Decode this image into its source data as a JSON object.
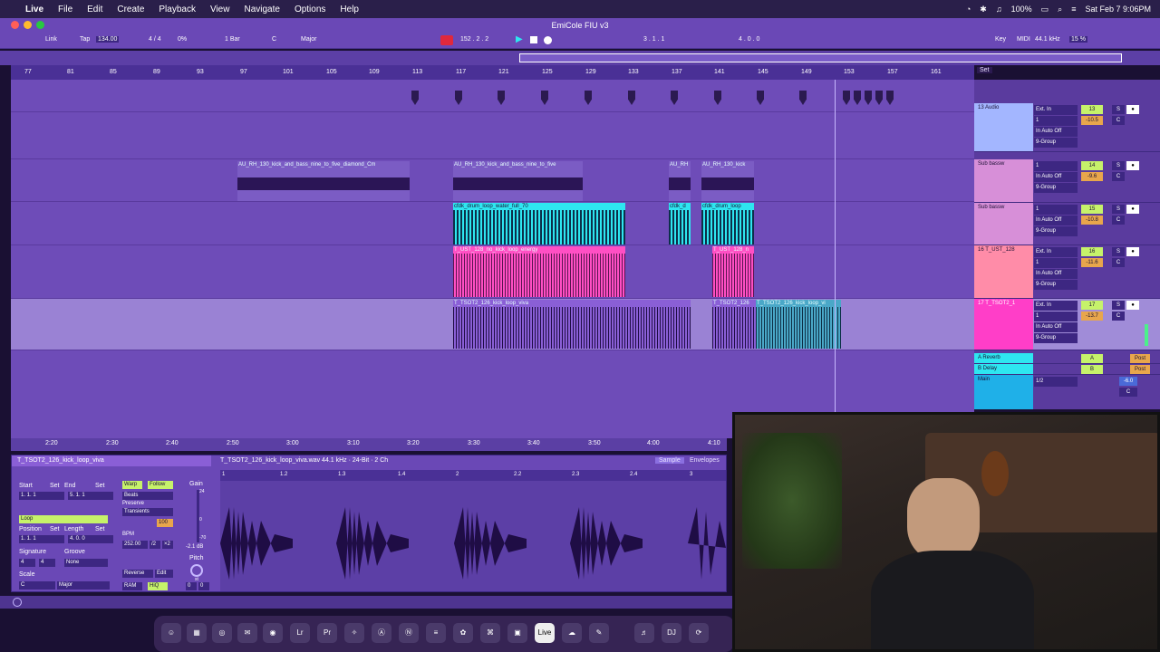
{
  "menubar": {
    "apple": "",
    "items": [
      "Live",
      "File",
      "Edit",
      "Create",
      "Playback",
      "View",
      "Navigate",
      "Options",
      "Help"
    ],
    "battery": "100%",
    "datetime": "Sat Feb 7  9:06PM"
  },
  "window": {
    "title": "EmiCole FIU v3"
  },
  "control": {
    "link": "Link",
    "tap": "Tap",
    "tempo": "134.00",
    "signature": "4 / 4",
    "percent": "0%",
    "quantize": "1 Bar",
    "key": "C",
    "scale": "Major",
    "position": "152 .  2 .  2",
    "loop_start": "3 .  1 .  1",
    "loop_length": "4 .  0 .  0",
    "key_btn": "Key",
    "midi_btn": "MIDI",
    "sample_rate": "44.1 kHz",
    "cpu": "15 %"
  },
  "ruler": {
    "bars": [
      "77",
      "81",
      "85",
      "89",
      "93",
      "97",
      "101",
      "105",
      "109",
      "113",
      "117",
      "121",
      "125",
      "129",
      "133",
      "137",
      "141",
      "145",
      "149",
      "153",
      "157",
      "161"
    ],
    "set": "Set"
  },
  "clips": [
    {
      "title": "AU_RH_130_kick_and_bass_nine_to_five_diamond_Cm",
      "color": "#7b5cc4"
    },
    {
      "title": "AU_RH_130_kick_and_bass_nine_to_five",
      "color": "#7b5cc4"
    },
    {
      "title": "AU_RH",
      "color": "#7b5cc4"
    },
    {
      "title": "AU_RH_130_kick",
      "color": "#7b5cc4"
    },
    {
      "title": "cfdk_drum_loop_water_full_70",
      "color": "#2ee6f0"
    },
    {
      "title": "cfdk_d",
      "color": "#2ee6f0"
    },
    {
      "title": "cfdk_drum_loop",
      "color": "#2ee6f0"
    },
    {
      "title": "T_UST_128_no_kick_loop_energy",
      "color": "#ff4fc4"
    },
    {
      "title": "T_UST_128_n",
      "color": "#ff4fc4"
    },
    {
      "title": "T_TSOT2_126_kick_loop_viva",
      "color": "#8a5fd6"
    },
    {
      "title": "T_TSOT2_126",
      "color": "#8a5fd6"
    },
    {
      "title": "T_TSOT2_126_kick_loop_vi",
      "color": "#4aa8c8"
    }
  ],
  "tracks": [
    {
      "name": "13 Audio",
      "input": "Ext. In",
      "ch": "1",
      "out": "9-Group",
      "num": "13",
      "vol": "-10.5",
      "pan": "C",
      "color": "#a3b6ff"
    },
    {
      "name": "Sub bassw",
      "input": "1",
      "ch": "",
      "out": "9-Group",
      "num": "14",
      "vol": "-9.6",
      "pan": "C",
      "color": "#d78fd8"
    },
    {
      "name": "Sub bassw",
      "input": "1",
      "ch": "",
      "out": "9-Group",
      "num": "15",
      "vol": "-10.8",
      "pan": "C",
      "color": "#d78fd8"
    },
    {
      "name": "16 T_UST_128",
      "input": "Ext. In",
      "ch": "1",
      "out": "9-Group",
      "num": "16",
      "vol": "-11.6",
      "pan": "C",
      "color": "#ff8ca8"
    },
    {
      "name": "17 T_TSOT2_1",
      "input": "Ext. In",
      "ch": "1",
      "out": "9-Group",
      "num": "17",
      "vol": "-13.7",
      "pan": "C",
      "color": "#ff3ec8"
    }
  ],
  "returns": [
    {
      "name": "A Reverb",
      "btn": "A",
      "post": "Post"
    },
    {
      "name": "B Delay",
      "btn": "B",
      "post": "Post"
    },
    {
      "name": "Main",
      "ratio": "1/2",
      "vol": "-6.0",
      "pan": "C"
    }
  ],
  "io_labels": {
    "in": "In",
    "auto": "Auto",
    "off": "Off",
    "inf": "-∞",
    "s": "S"
  },
  "timeaxis": [
    "2:20",
    "2:30",
    "2:40",
    "2:50",
    "3:00",
    "3:10",
    "3:20",
    "3:30",
    "3:40",
    "3:50",
    "4:00",
    "4:10"
  ],
  "clipview": {
    "clip_name": "T_TSOT2_126_kick_loop_viva",
    "file_info": "T_TSOT2_126_kick_loop_viva.wav  44.1 kHz · 24-Bit · 2 Ch",
    "tab_sample": "Sample",
    "tab_envelopes": "Envelopes",
    "start": "Start",
    "end": "End",
    "set": "Set",
    "start_val": "1.  1.  1",
    "end_val": "5.  1.  1",
    "loop": "Loop",
    "position": "Position",
    "length": "Length",
    "pos_val": "1.  1.  1",
    "len_val": "4.  0.  0",
    "signature": "Signature",
    "groove": "Groove",
    "sig_num": "4",
    "sig_den": "4",
    "groove_val": "None",
    "scale": "Scale",
    "scale_key": "C",
    "scale_mode": "Major",
    "warp": "Warp",
    "follow": "Follow",
    "beats": "Beats",
    "preserve": "Preserve",
    "transients": "Transients",
    "percent": "100",
    "bpm_label": "BPM",
    "bpm": "252.00",
    "half": "/2",
    "double": "×2",
    "reverse": "Reverse",
    "edit": "Edit",
    "ram": "RAM",
    "hiq": "HiQ",
    "gain": "Gain",
    "gain_val": "-2.1 dB",
    "pitch": "Pitch",
    "pitch_val": "0",
    "detune_val": "0",
    "db_top": "24",
    "db_mid": "0",
    "db_bot": "-70",
    "st_unit": "st",
    "beat_marks": [
      "1",
      "1.2",
      "1.3",
      "1.4",
      "2",
      "2.2",
      "2.3",
      "2.4",
      "3"
    ]
  },
  "dock": {
    "items": [
      "Finder",
      "Launchpad",
      "AirDrop",
      "Messages",
      "Obs",
      "Lr",
      "Pr",
      "Compass",
      "Xcode",
      "Note",
      "Mixer",
      "ChatGPT",
      "Cmd",
      "Terminal",
      "Live",
      "Cloud",
      "Pen",
      "Spotify",
      "DJ",
      "Sync"
    ]
  }
}
